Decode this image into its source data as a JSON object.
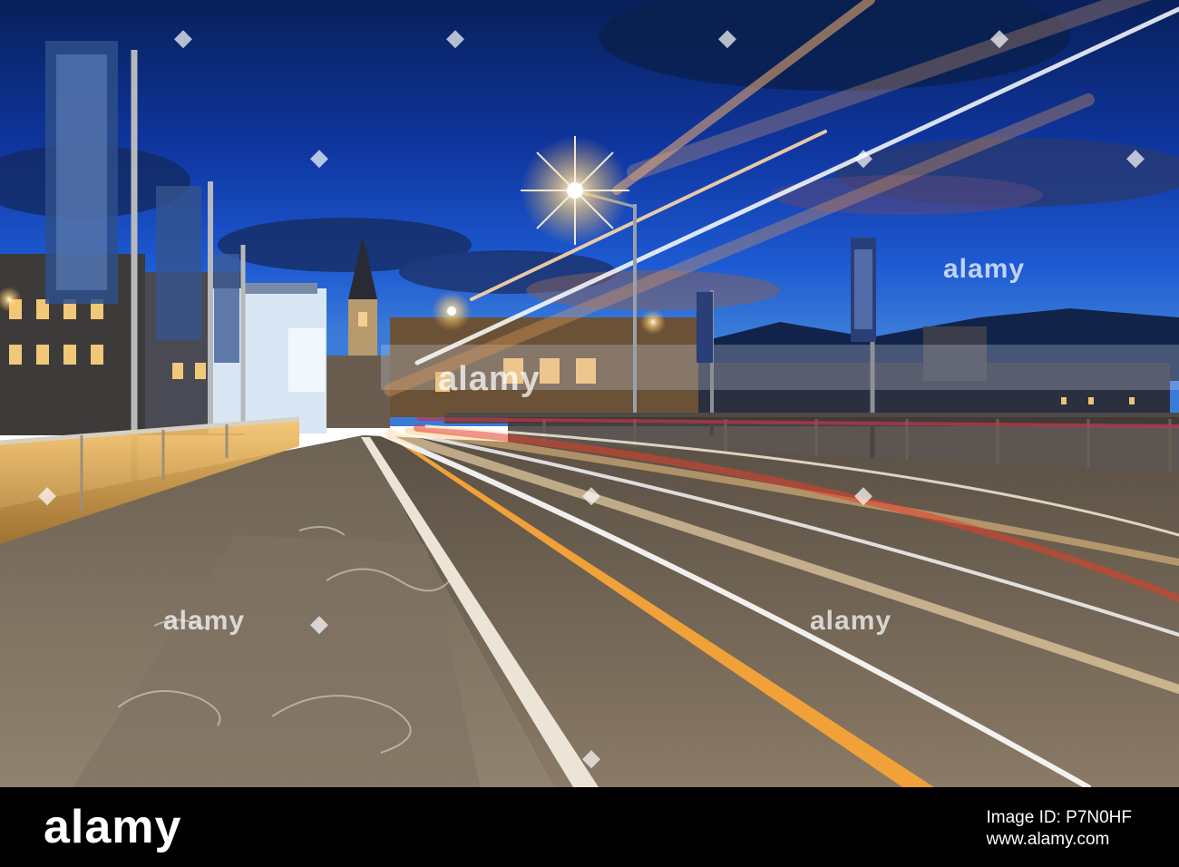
{
  "photo": {
    "scene": "night-bridge-light-trails",
    "sky_colors": [
      "#0b2a6e",
      "#123b96",
      "#1e56c8"
    ],
    "glow_color": "#f4b35a",
    "trail_colors": [
      "#ffffff",
      "#ffd08a",
      "#e2402a"
    ]
  },
  "watermark": {
    "main": "alamy",
    "tiles": [
      "alamy",
      "alamy",
      "alamy"
    ]
  },
  "footer": {
    "logo": "alamy",
    "image_id_label": "Image ID: P7N0HF",
    "url": "www.alamy.com"
  }
}
